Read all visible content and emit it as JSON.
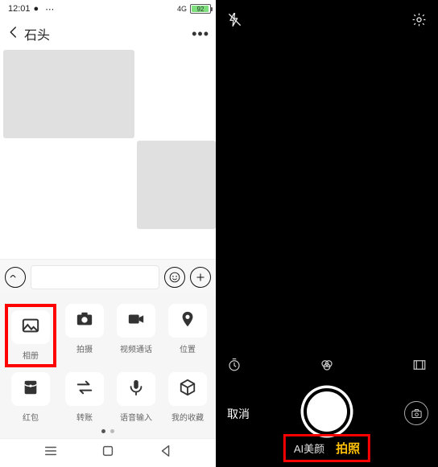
{
  "status": {
    "time": "12:01",
    "signal_text": "4G",
    "battery_pct": "92"
  },
  "header": {
    "title": "石头"
  },
  "panel": {
    "items": [
      {
        "label": "相册"
      },
      {
        "label": "拍摄"
      },
      {
        "label": "视频通话"
      },
      {
        "label": "位置"
      },
      {
        "label": "红包"
      },
      {
        "label": "转账"
      },
      {
        "label": "语音输入"
      },
      {
        "label": "我的收藏"
      }
    ]
  },
  "camera": {
    "cancel": "取消",
    "modes": {
      "beauty": "AI美颜",
      "photo": "拍照"
    }
  }
}
